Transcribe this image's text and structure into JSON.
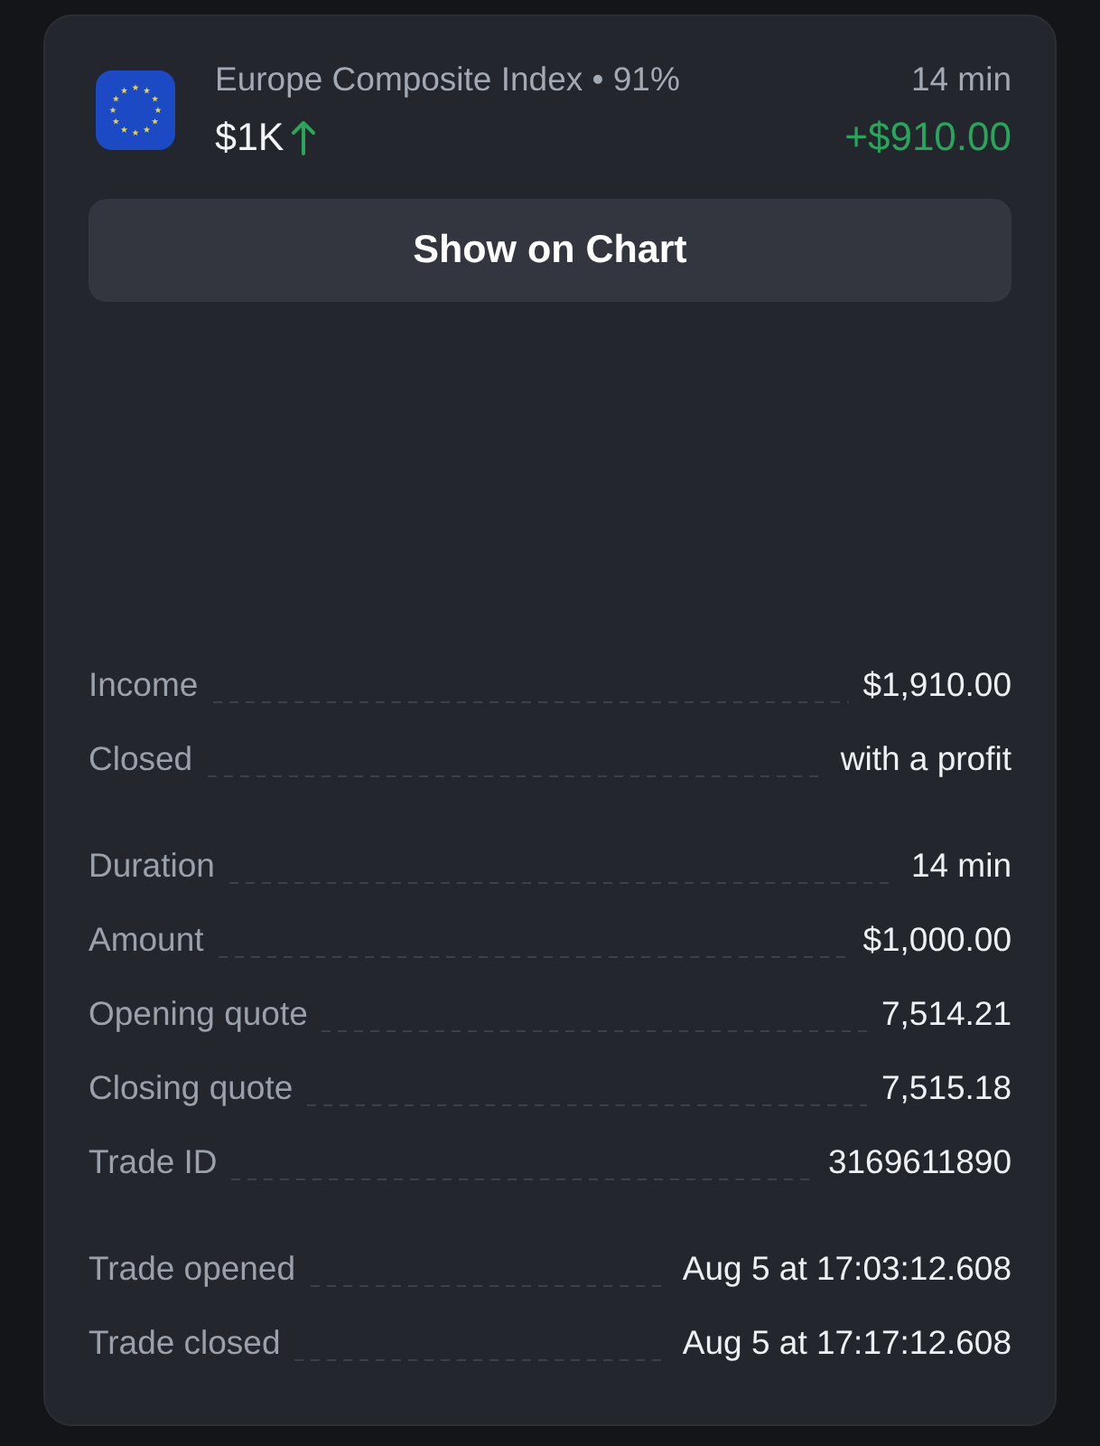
{
  "header": {
    "title": "Europe Composite Index • 91%",
    "time": "14 min",
    "amount": "$1K",
    "rising": true,
    "profit": "+$910.00"
  },
  "button": {
    "label": "Show on Chart"
  },
  "detail_groups": [
    {
      "rows": [
        {
          "label": "Income",
          "value": "$1,910.00"
        },
        {
          "label": "Closed",
          "value": "with a profit"
        }
      ]
    },
    {
      "rows": [
        {
          "label": "Duration",
          "value": "14 min"
        },
        {
          "label": "Amount",
          "value": "$1,000.00"
        },
        {
          "label": "Opening quote",
          "value": "7,514.21"
        },
        {
          "label": "Closing quote",
          "value": "7,515.18"
        },
        {
          "label": "Trade ID",
          "value": "3169611890"
        }
      ]
    },
    {
      "rows": [
        {
          "label": "Trade opened",
          "value": "Aug 5 at 17:03:12.608"
        },
        {
          "label": "Trade closed",
          "value": "Aug 5 at 17:17:12.608"
        }
      ]
    }
  ]
}
